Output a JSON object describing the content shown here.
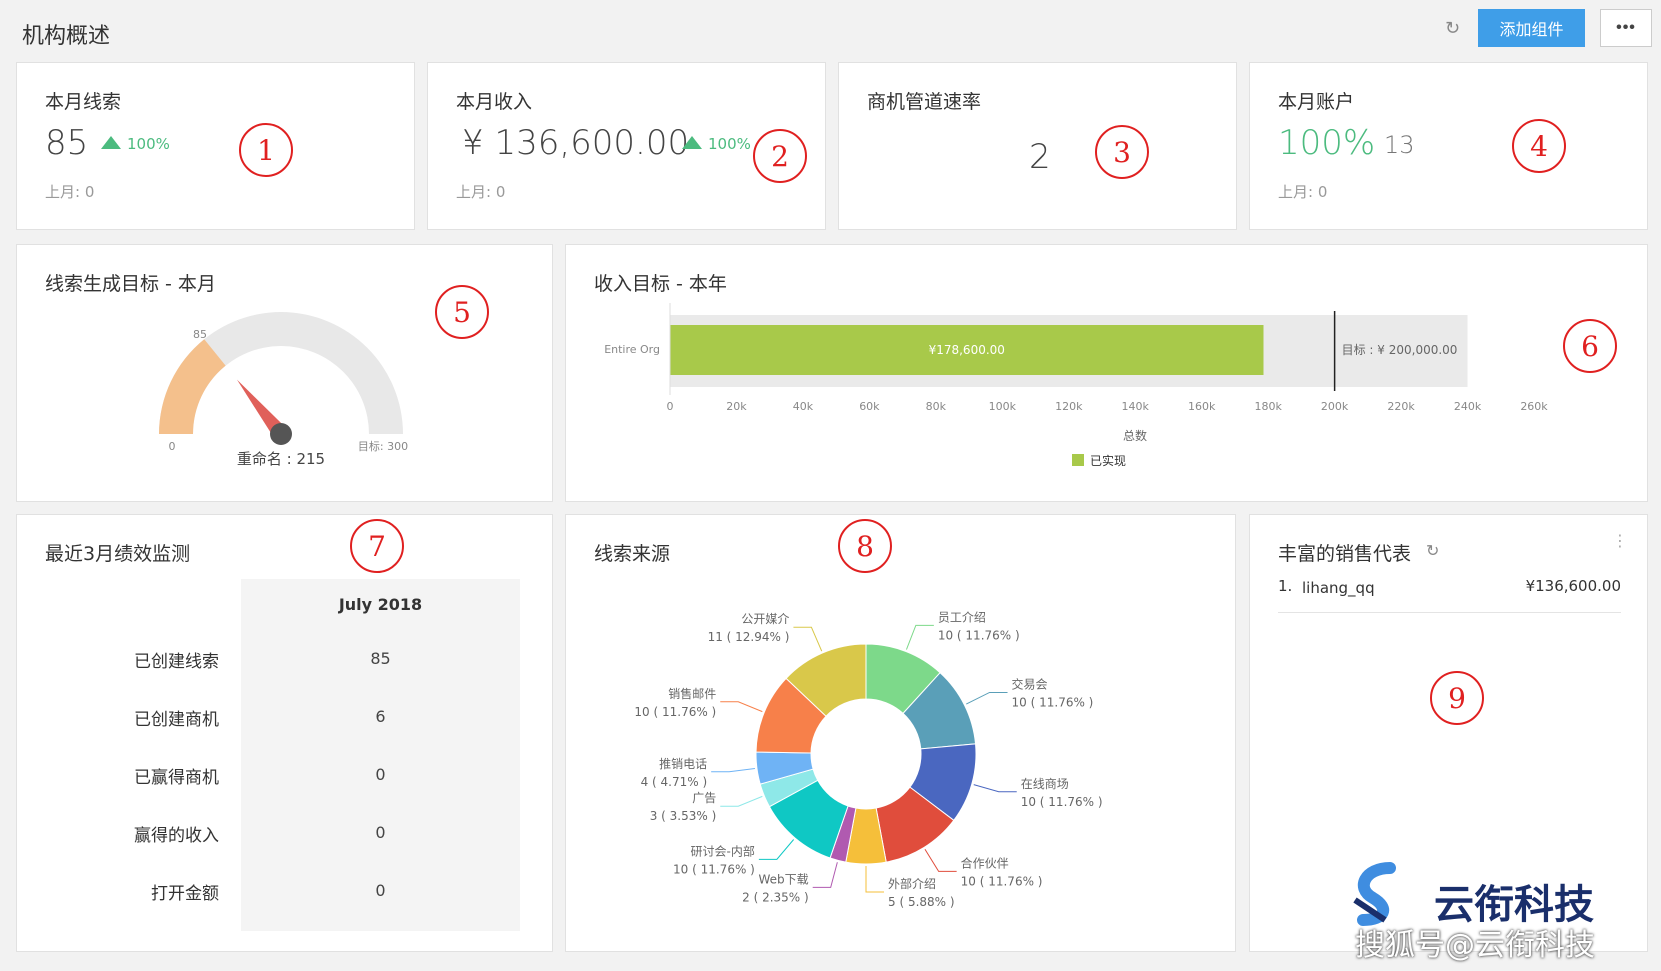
{
  "header": {
    "title": "机构概述",
    "add_label": "添加组件",
    "more_label": "•••"
  },
  "kpi": [
    {
      "title": "本月线索",
      "value": "85",
      "change": "100%",
      "prev": "上月: 0",
      "marker": "1"
    },
    {
      "title": "本月收入",
      "value": "¥ 136,600.00",
      "change": "100%",
      "prev": "上月: 0",
      "marker": "2"
    },
    {
      "title": "商机管道速率",
      "value": "2",
      "marker": "3"
    },
    {
      "title": "本月账户",
      "value": "100%",
      "count": "13",
      "prev": "上月: 0",
      "marker": "4"
    }
  ],
  "gauge": {
    "title": "线索生成目标 - 本月",
    "min_label": "0",
    "current_label": "85",
    "target_label": "目标: 300",
    "needle_label": "重命名 : 215",
    "current": 85,
    "target": 300,
    "marker": "5"
  },
  "revenue_goal": {
    "title": "收入目标 - 本年",
    "marker": "6",
    "chart_data": {
      "type": "bar",
      "categories": [
        "Entire Org"
      ],
      "series": [
        {
          "name": "已实现",
          "values": [
            178600
          ]
        }
      ],
      "bar_label": "¥178,600.00",
      "target": 200000,
      "target_label": "目标 : ¥ 200,000.00",
      "xlim": [
        0,
        260000
      ],
      "xticks": [
        "0",
        "20k",
        "40k",
        "60k",
        "80k",
        "100k",
        "120k",
        "140k",
        "160k",
        "180k",
        "200k",
        "220k",
        "240k",
        "260k"
      ],
      "xlabel": "总数",
      "legend": "已实现",
      "color": "#a8c94a"
    }
  },
  "performance": {
    "title": "最近3月绩效监测",
    "column": "July 2018",
    "marker": "7",
    "rows": [
      {
        "label": "已创建线索",
        "value": "85"
      },
      {
        "label": "已创建商机",
        "value": "6"
      },
      {
        "label": "已赢得商机",
        "value": "0"
      },
      {
        "label": "赢得的收入",
        "value": "0"
      },
      {
        "label": "打开金额",
        "value": "0"
      }
    ]
  },
  "lead_source": {
    "title": "线索来源",
    "marker": "8",
    "chart_data": {
      "type": "pie",
      "slices": [
        {
          "name": "员工介绍",
          "value": 10,
          "pct": "10 ( 11.76% )",
          "color": "#7dd98a"
        },
        {
          "name": "交易会",
          "value": 10,
          "pct": "10 ( 11.76% )",
          "color": "#5a9fb8"
        },
        {
          "name": "在线商场",
          "value": 10,
          "pct": "10 ( 11.76% )",
          "color": "#4a67c0"
        },
        {
          "name": "合作伙伴",
          "value": 10,
          "pct": "10 ( 11.76% )",
          "color": "#e04d3c"
        },
        {
          "name": "外部介绍",
          "value": 5,
          "pct": "5 ( 5.88% )",
          "color": "#f5bf3a"
        },
        {
          "name": "Web下载",
          "value": 2,
          "pct": "2 ( 2.35% )",
          "color": "#b05ab0"
        },
        {
          "name": "研讨会-内部",
          "value": 10,
          "pct": "10 ( 11.76% )",
          "color": "#0fc8c4"
        },
        {
          "name": "广告",
          "value": 3,
          "pct": "3 ( 3.53% )",
          "color": "#8ee8e8"
        },
        {
          "name": "推销电话",
          "value": 4,
          "pct": "4 ( 4.71% )",
          "color": "#6fb3f5"
        },
        {
          "name": "销售邮件",
          "value": 10,
          "pct": "10 ( 11.76% )",
          "color": "#f7804a"
        },
        {
          "name": "公开媒介",
          "value": 11,
          "pct": "11 ( 12.94% )",
          "color": "#d9c84a"
        }
      ]
    }
  },
  "sales_rep": {
    "title": "丰富的销售代表",
    "marker": "9",
    "rows": [
      {
        "rank": "1.",
        "name": "lihang_qq",
        "amount": "¥136,600.00"
      }
    ]
  },
  "watermark": {
    "main": "云衔科技",
    "sub": "搜狐号@云衔科技"
  }
}
